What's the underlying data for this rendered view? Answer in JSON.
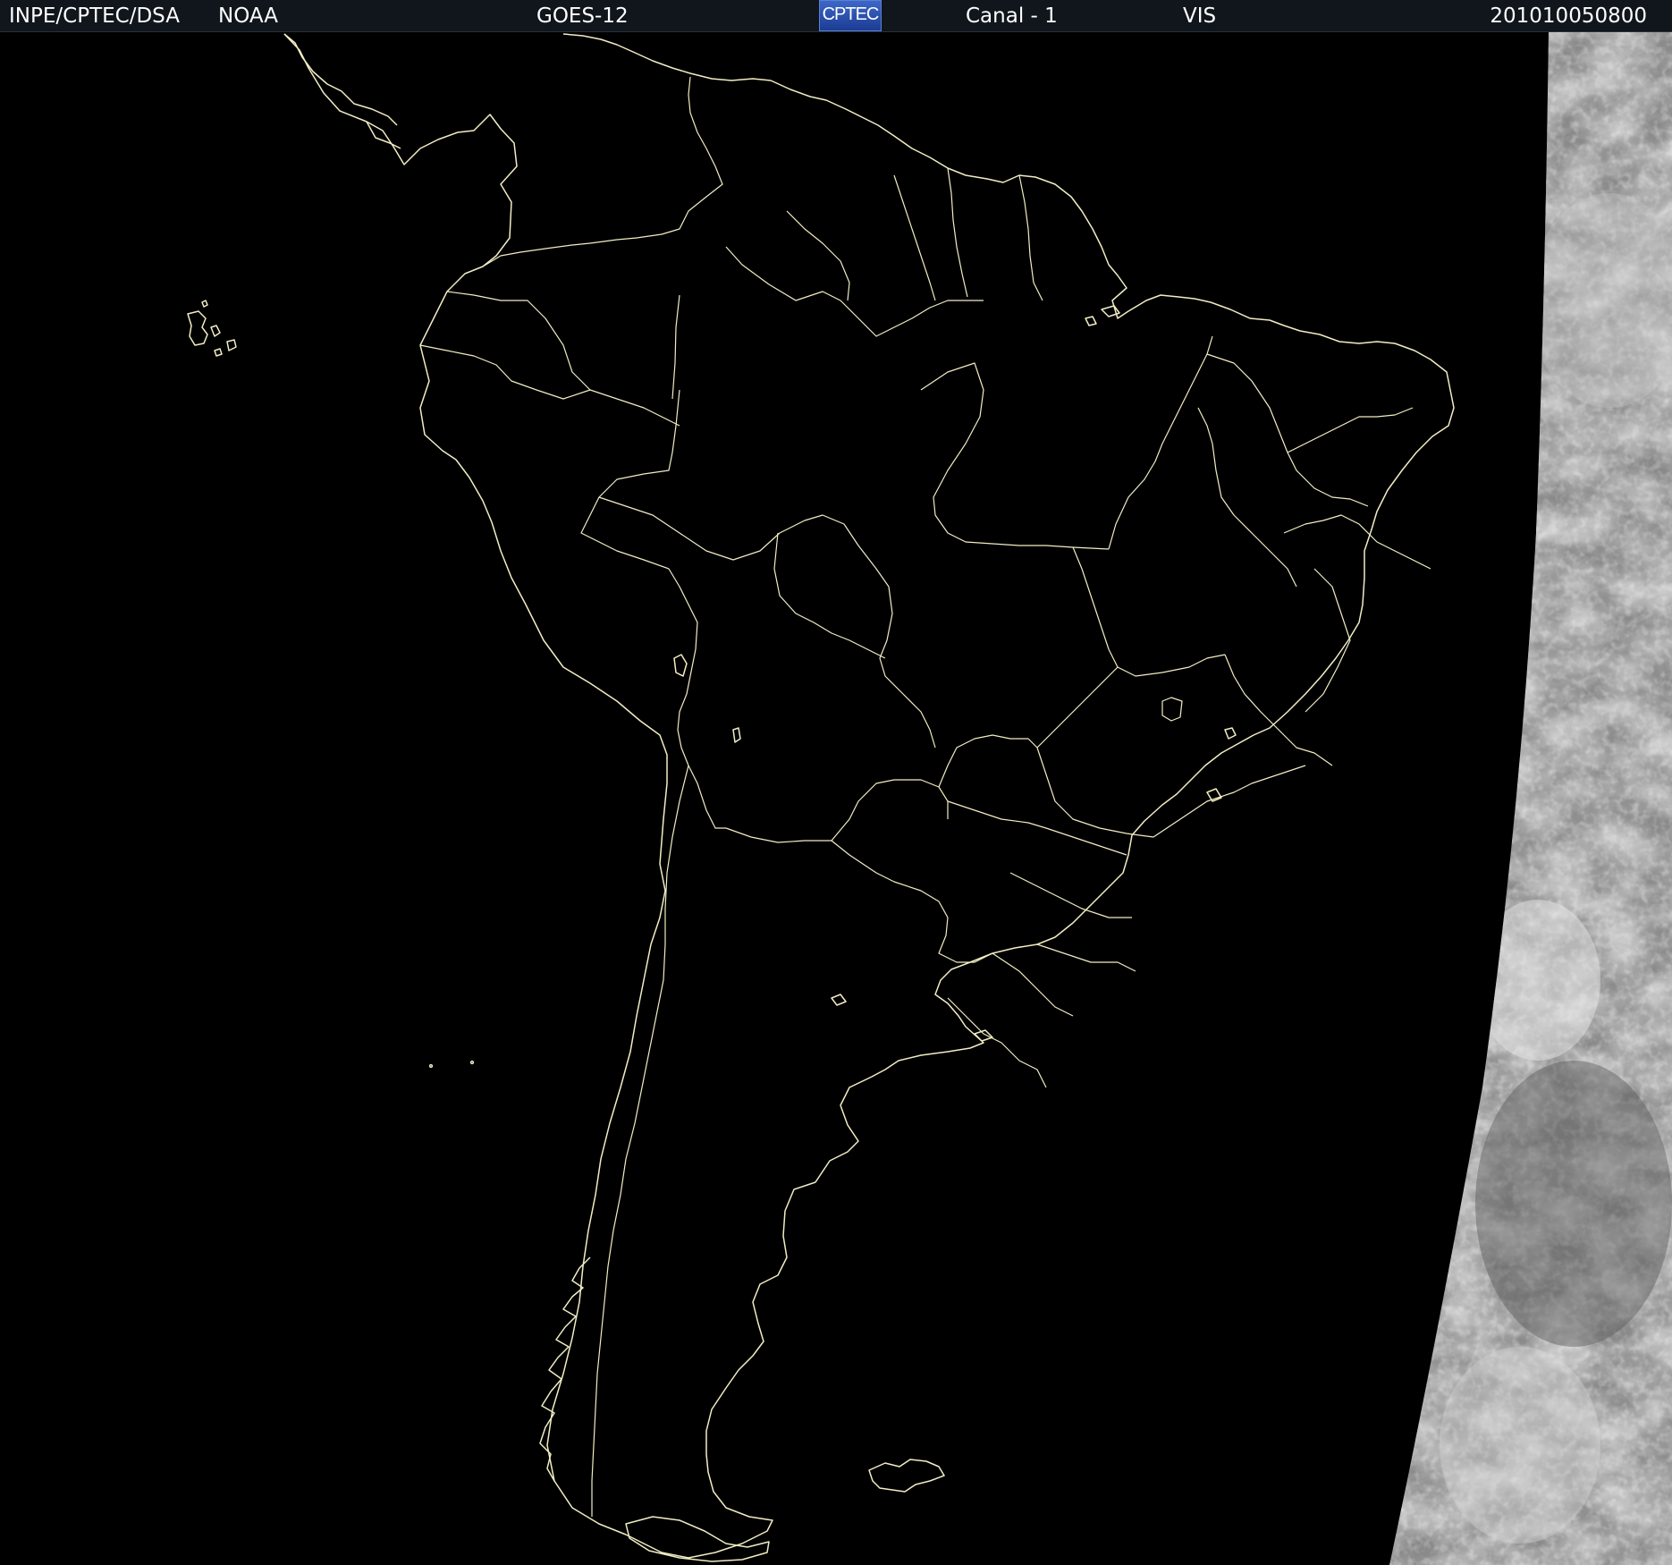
{
  "header": {
    "organization": "INPE/CPTEC/DSA",
    "agency": "NOAA",
    "satellite": "GOES-12",
    "logo_text": "CPTEC",
    "channel": "Canal - 1",
    "band": "VIS",
    "timestamp": "201010050800"
  },
  "colors": {
    "header_background": "#10161c",
    "header_text": "#ffffff",
    "map_background": "#000000",
    "outline": "#f2edc4",
    "logo_background": "#2d56b8",
    "cloud_light": "#e6e6e6",
    "cloud_dark": "#6e6e6e"
  },
  "map": {
    "region": "South America",
    "projection": "satellite view",
    "boundaries": [
      "coastlines",
      "country borders",
      "Brazilian state borders"
    ],
    "imagery": "visible channel, illuminated only on the eastern edge"
  }
}
